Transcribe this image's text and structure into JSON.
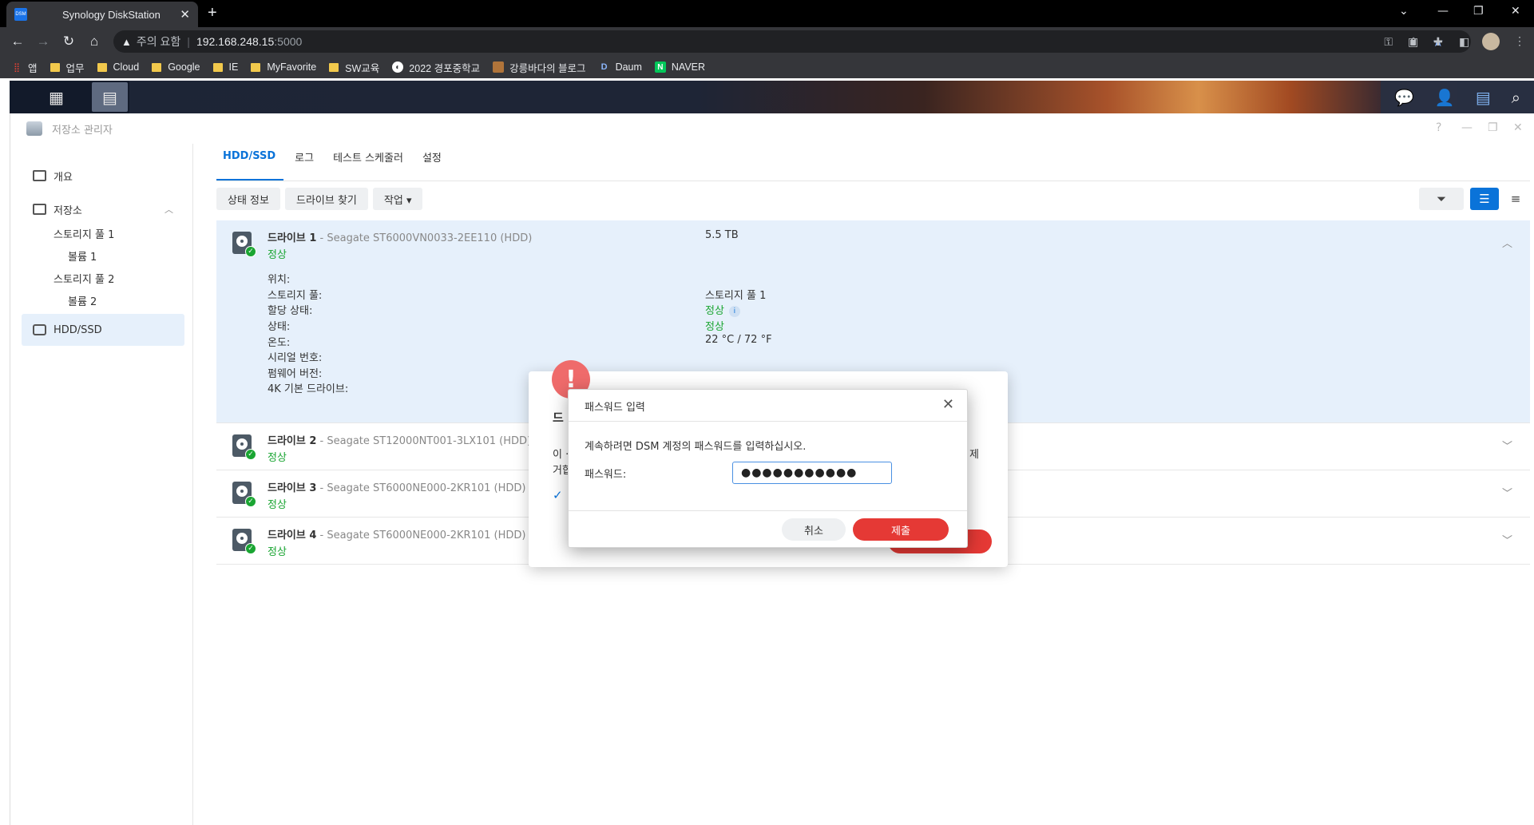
{
  "browser": {
    "tab_title": "Synology DiskStation",
    "favicon_text": "DSM",
    "security_label": "주의 요함",
    "url_host": "192.168.248.15",
    "url_port": ":5000",
    "bookmarks": [
      {
        "label": "앱",
        "icon": "apps-grid-icon"
      },
      {
        "label": "업무",
        "icon": "folder-icon"
      },
      {
        "label": "Cloud",
        "icon": "folder-icon"
      },
      {
        "label": "Google",
        "icon": "folder-icon"
      },
      {
        "label": "IE",
        "icon": "folder-icon"
      },
      {
        "label": "MyFavorite",
        "icon": "folder-icon"
      },
      {
        "label": "SW교육",
        "icon": "folder-icon"
      },
      {
        "label": "2022 경포중학교",
        "icon": "globe-icon"
      },
      {
        "label": "강릉바다의 블로그",
        "icon": "blog-icon"
      },
      {
        "label": "Daum",
        "icon": "daum-icon"
      },
      {
        "label": "NAVER",
        "icon": "naver-icon"
      }
    ]
  },
  "window": {
    "title": "저장소 관리자"
  },
  "sidebar": {
    "items": [
      {
        "label": "개요"
      },
      {
        "label": "저장소"
      },
      {
        "label": "스토리지 풀 1"
      },
      {
        "label": "볼륨 1"
      },
      {
        "label": "스토리지 풀 2"
      },
      {
        "label": "볼륨 2"
      },
      {
        "label": "HDD/SSD"
      }
    ]
  },
  "tabs": [
    "HDD/SSD",
    "로그",
    "테스트 스케줄러",
    "설정"
  ],
  "actions": {
    "status_info": "상태 정보",
    "find_drive": "드라이브 찾기",
    "action": "작업 ▾"
  },
  "drives": [
    {
      "name": "드라이브 1",
      "model": " - Seagate ST6000VN0033-2EE110 (HDD)",
      "status": "정상",
      "size": "5.5 TB"
    },
    {
      "name": "드라이브 2",
      "model": " - Seagate ST12000NT001-3LX101 (HDD)",
      "status": "정상"
    },
    {
      "name": "드라이브 3",
      "model": " - Seagate ST6000NE000-2KR101 (HDD)",
      "status": "정상"
    },
    {
      "name": "드라이브 4",
      "model": " - Seagate ST6000NE000-2KR101 (HDD)",
      "status": "정상"
    }
  ],
  "drive1_details": {
    "labels": [
      "위치:",
      "스토리지 풀:",
      "할당 상태:",
      "상태:",
      "온도:",
      "시리얼 번호:",
      "펌웨어 버전:",
      "4K 기본 드라이브:"
    ],
    "storage_pool": "스토리지 풀 1",
    "allocation": "정상",
    "status": "정상",
    "temperature": "22 °C / 72 °F"
  },
  "warning_dialog": {
    "title_frag": "드",
    "line1_frag": "이 ·",
    "line2_frag": "거합",
    "right_frag": "제"
  },
  "password_dialog": {
    "title": "패스워드 입력",
    "message": "계속하려면 DSM 계정의 패스워드를 입력하십시오.",
    "label": "패스워드:",
    "value": "●●●●●●●●●●●",
    "cancel": "취소",
    "submit": "제출"
  }
}
